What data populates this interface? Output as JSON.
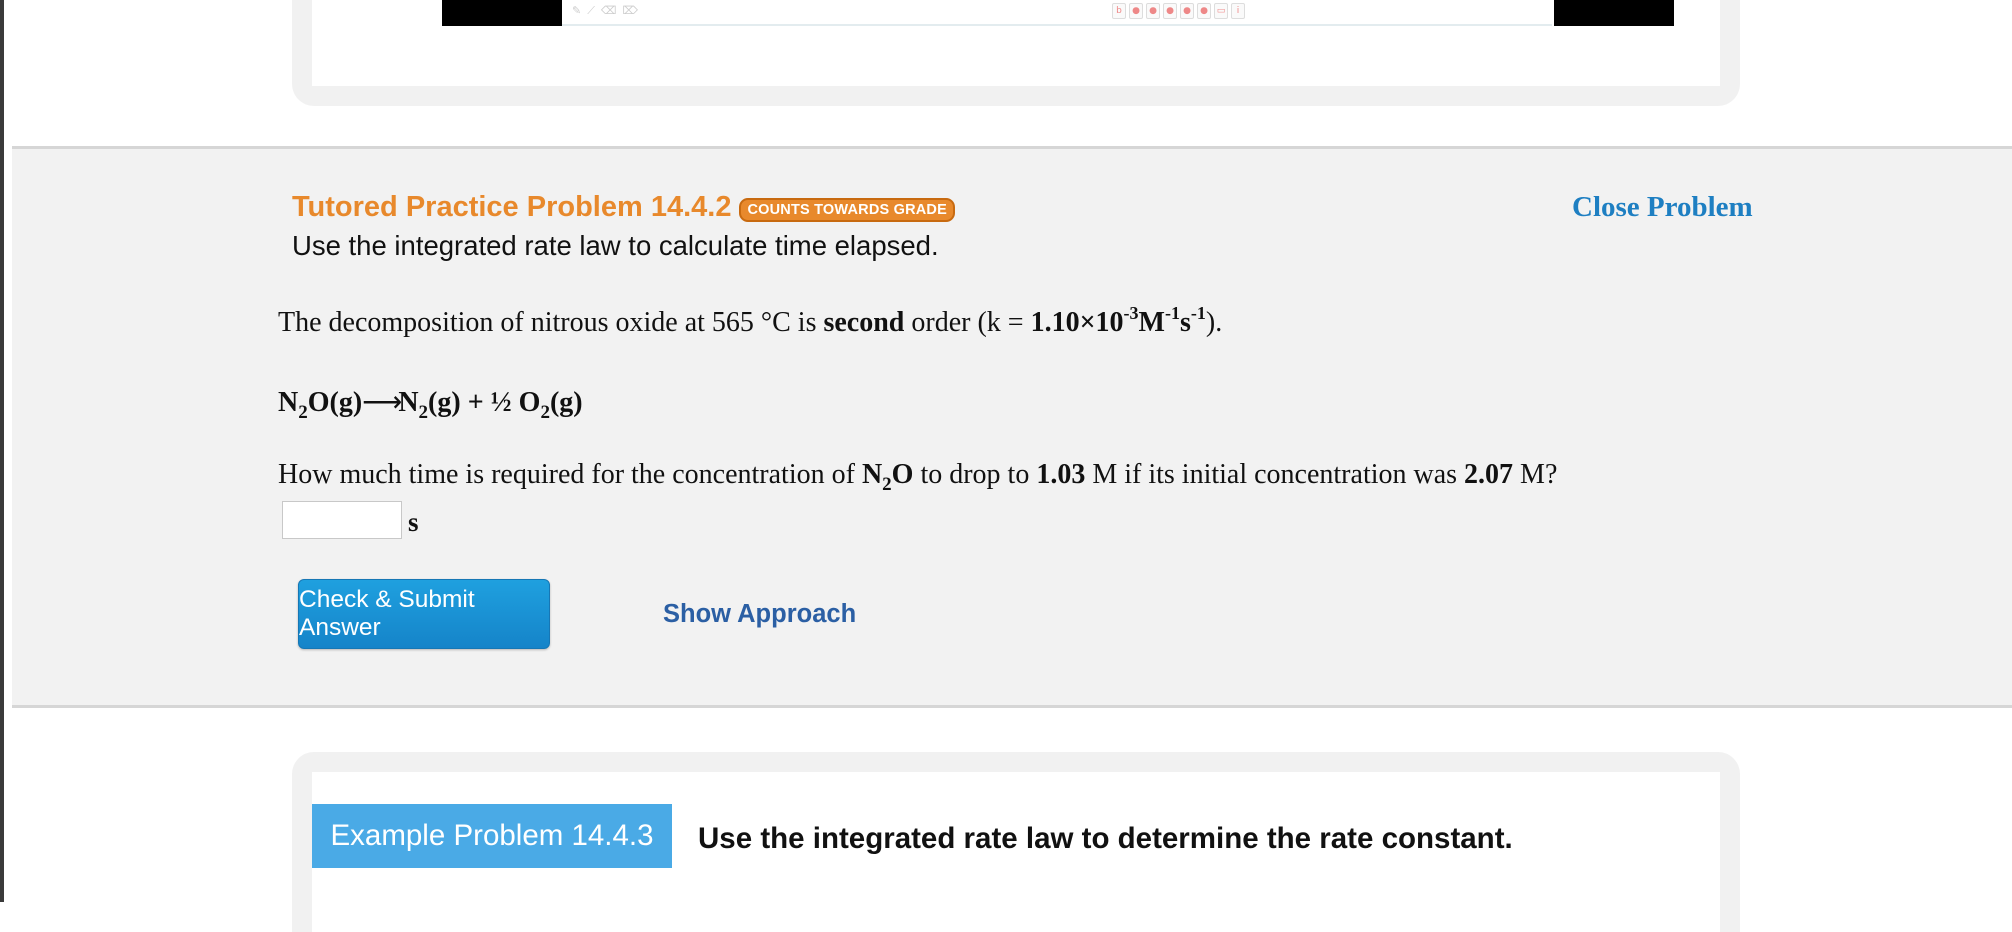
{
  "colors": {
    "accent_orange": "#e8892c",
    "link_blue": "#1e7fc2",
    "button_blue": "#1584c9",
    "approach_blue": "#2b5fa4",
    "example_tag_blue": "#4aaae6",
    "panel_gray": "#f2f2f2"
  },
  "problem": {
    "title": "Tutored Practice Problem 14.4.2",
    "badge": "COUNTS TOWARDS GRADE",
    "subtitle": "Use the integrated rate law to calculate time elapsed.",
    "close_label": "Close Problem",
    "statement": {
      "text1": "The decomposition of nitrous oxide at 565 °C is ",
      "bold1": "second",
      "text2": " order (k = ",
      "k_value": "1.10×10",
      "exp1": "-3",
      "unit_M": "M",
      "exp2": "-1",
      "unit_s": "s",
      "exp3": "-1",
      "text3": ")."
    },
    "equation": {
      "reactant": "N",
      "reactant_sub": "2",
      "reactant_rest": "O(g)",
      "arrow": "⟶",
      "product1": "N",
      "product1_sub": "2",
      "product1_rest": "(g) + ½ O",
      "product2_sub": "2",
      "product2_rest": "(g)"
    },
    "question": {
      "text1": "How much time is required for the concentration of ",
      "species": "N",
      "species_sub": "2",
      "species_rest": "O",
      "text2": " to drop to ",
      "final_conc": "1.03",
      "text3": " M if its initial concentration was ",
      "initial_conc": "2.07",
      "text4": " M?"
    },
    "answer": {
      "value": "",
      "unit": "s"
    },
    "submit_label": "Check & Submit Answer",
    "approach_label": "Show Approach"
  },
  "example": {
    "tag": "Example Problem 14.4.3",
    "title": "Use the integrated rate law to determine the rate constant."
  }
}
